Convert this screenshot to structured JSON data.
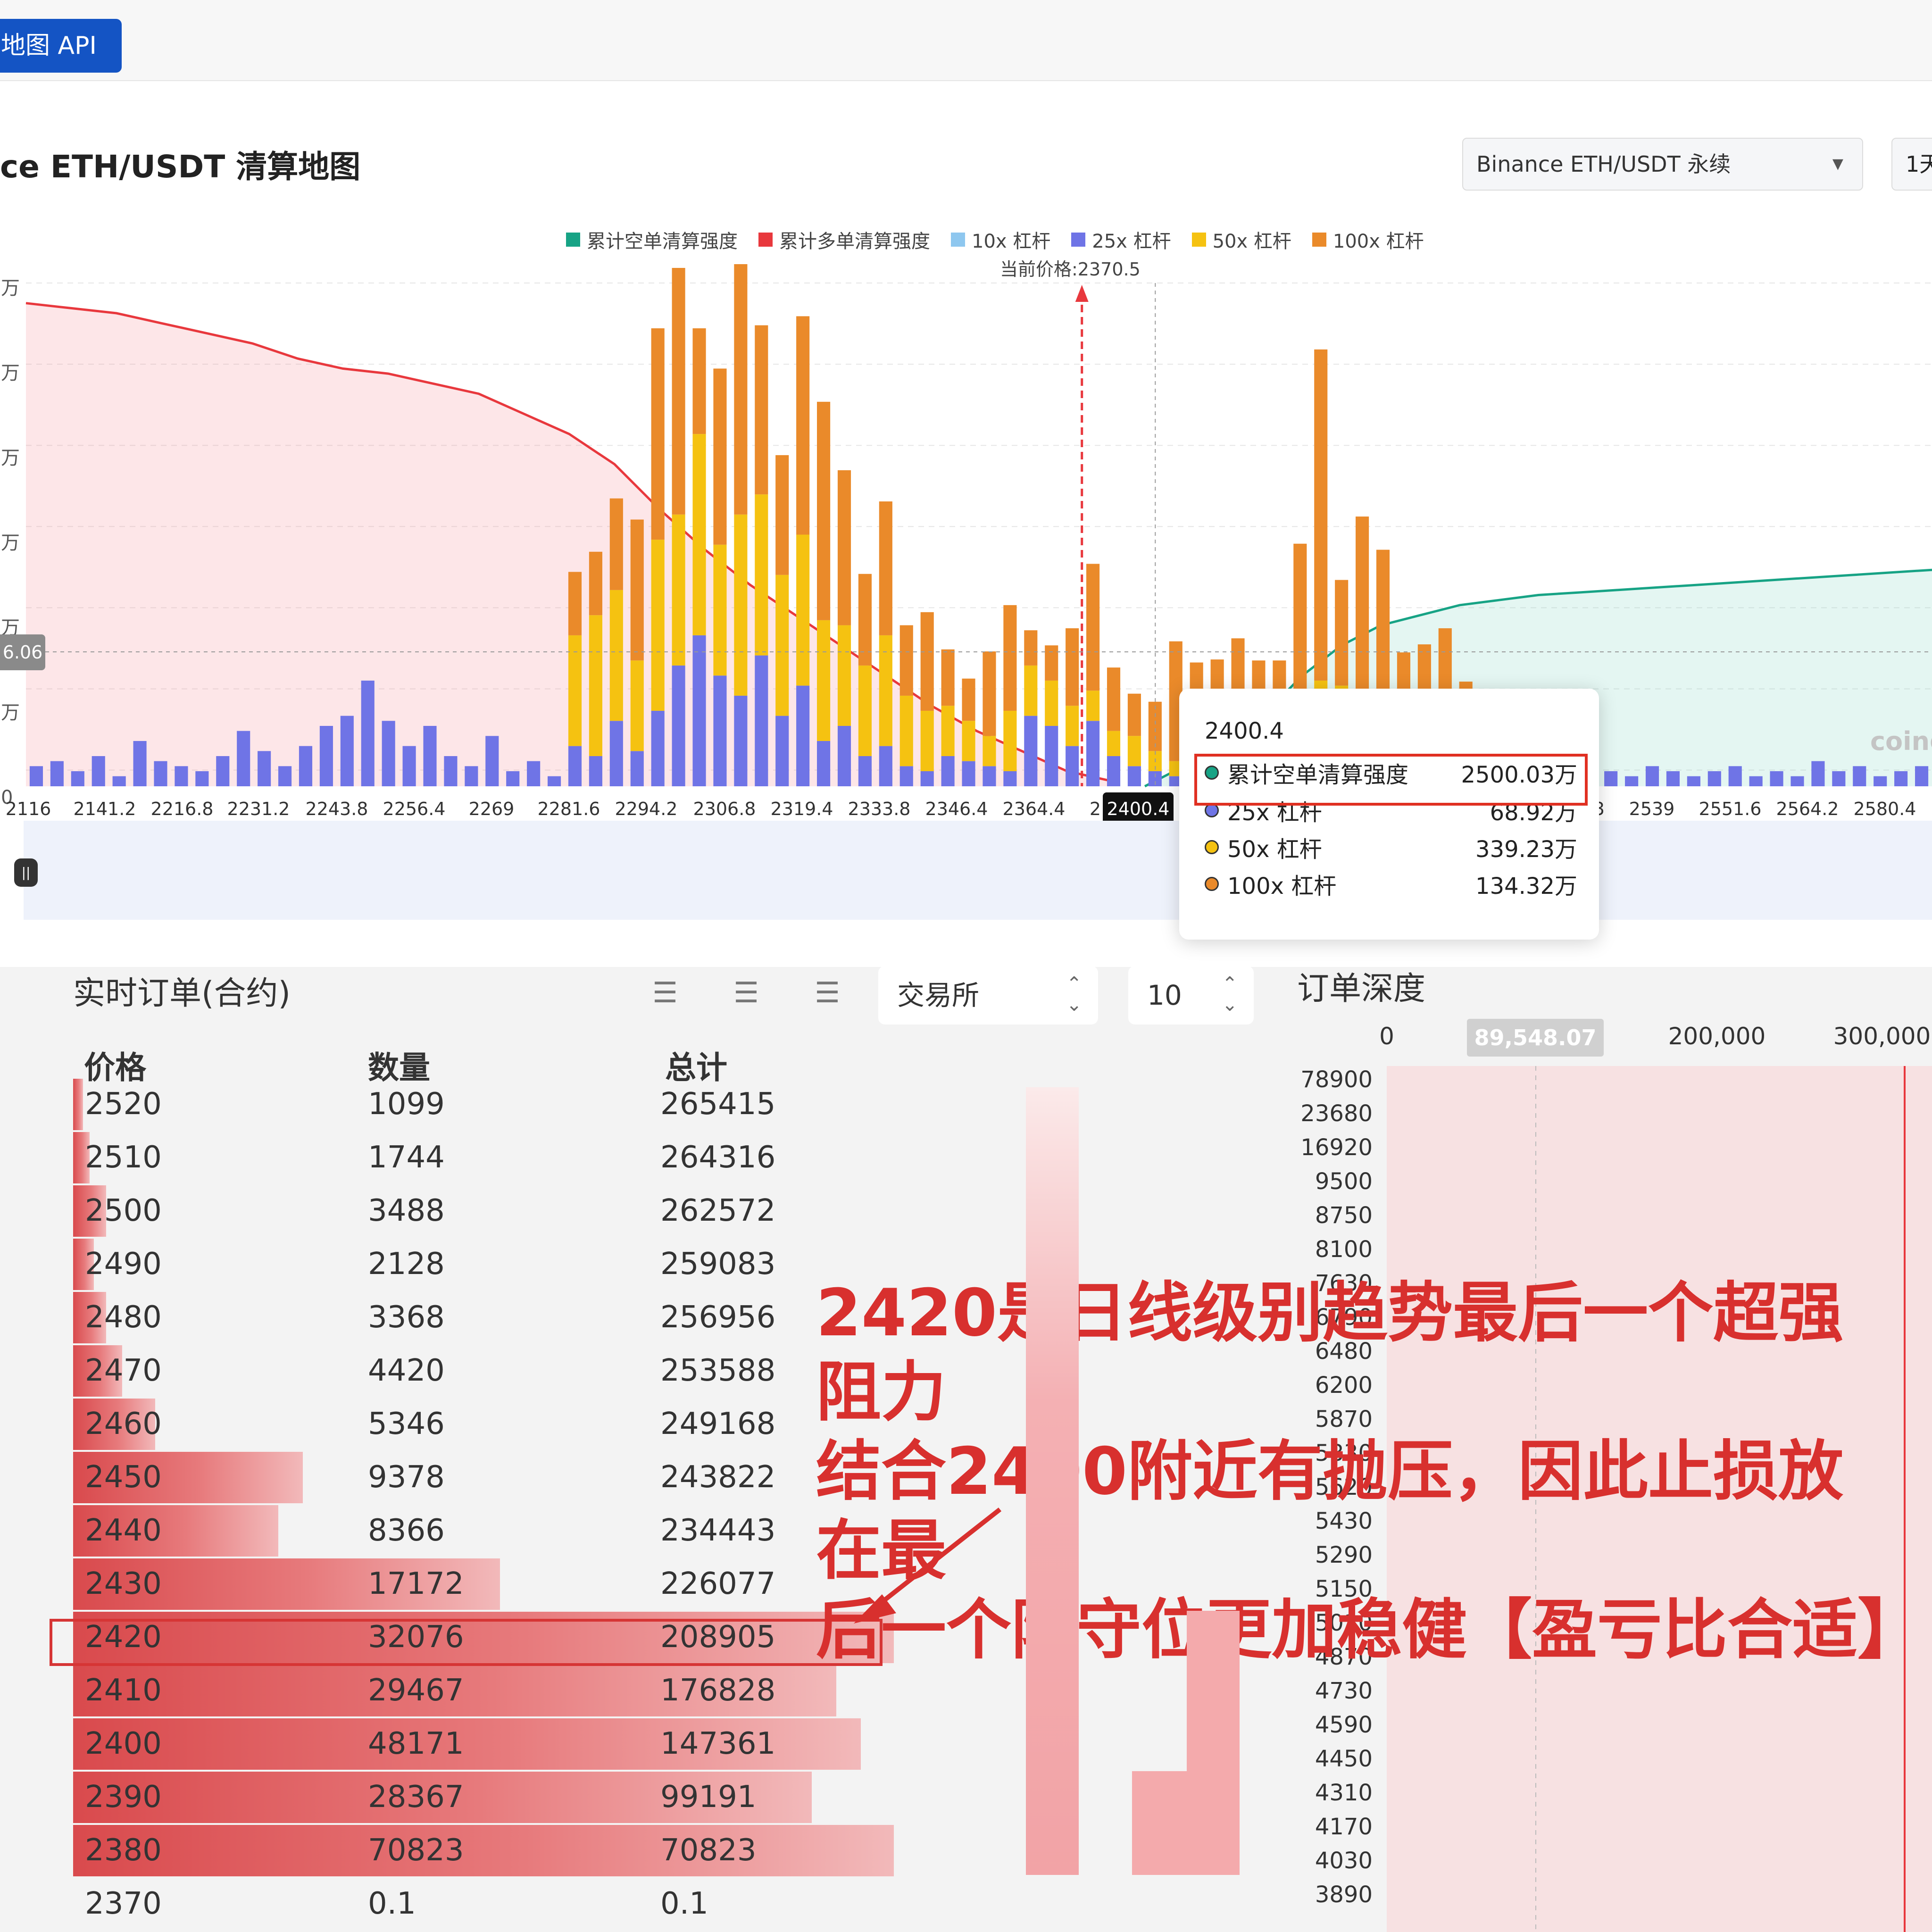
{
  "header": {
    "api_button": "地图 API"
  },
  "title": "ce ETH/USDT 清算地图",
  "market_select": {
    "value": "Binance ETH/USDT 永续"
  },
  "range_select": {
    "value": "1天"
  },
  "legend": [
    {
      "label": "累计空单清算强度",
      "color": "#17a385"
    },
    {
      "label": "累计多单清算强度",
      "color": "#e8383d"
    },
    {
      "label": "10x 杠杆",
      "color": "#8ec7ef"
    },
    {
      "label": "25x 杠杆",
      "color": "#6f74e6"
    },
    {
      "label": "50x 杠杆",
      "color": "#f5c211"
    },
    {
      "label": "100x 杠杆",
      "color": "#ea8a2a"
    }
  ],
  "current_price_note": "当前价格:2370.5",
  "y_cursor_label": "6.06",
  "x_cursor_label": "2400.4",
  "y_tick_fragments": [
    "万",
    "万",
    "万",
    "万",
    "万",
    "万",
    "0"
  ],
  "watermark": "coing",
  "tooltip": {
    "price": "2400.4",
    "rows": [
      {
        "label": "累计空单清算强度",
        "value": "2500.03万",
        "color": "#17a385"
      },
      {
        "label": "25x 杠杆",
        "value": "68.92万",
        "color": "#6f74e6"
      },
      {
        "label": "50x 杠杆",
        "value": "339.23万",
        "color": "#f5c211"
      },
      {
        "label": "100x 杠杆",
        "value": "134.32万",
        "color": "#ea8a2a"
      }
    ]
  },
  "chart_data": {
    "type": "bar",
    "x_ticks": [
      "2116",
      "2141.2",
      "2216.8",
      "2231.2",
      "2243.8",
      "2256.4",
      "2269",
      "2281.6",
      "2294.2",
      "2306.8",
      "2319.4",
      "2333.8",
      "2346.4",
      "2364.4",
      "2",
      "2400.4",
      "3",
      "2539",
      "2551.6",
      "2564.2",
      "2580.4"
    ],
    "current_price": 2370.5,
    "series": [
      {
        "name": "累计多单清算强度",
        "kind": "area",
        "values": [
          96,
          95,
          94,
          92,
          90,
          88,
          85,
          83,
          82,
          80,
          78,
          74,
          70,
          64,
          55,
          47,
          40,
          34,
          28,
          22,
          16,
          11,
          7,
          3,
          1
        ]
      },
      {
        "name": "累计空单清算强度",
        "kind": "area",
        "values": [
          0,
          4,
          8,
          14,
          22,
          28,
          32,
          34,
          36,
          37,
          38,
          38.5,
          39,
          39.5,
          40,
          40.5,
          41,
          41.5,
          42,
          42.5,
          43
        ]
      },
      {
        "name": "25x 杠杆",
        "kind": "bars",
        "values": [
          4,
          5,
          3,
          6,
          2,
          9,
          5,
          4,
          3,
          6,
          11,
          7,
          4,
          8,
          12,
          14,
          21,
          13,
          8,
          12,
          6,
          4,
          10,
          3,
          5,
          2,
          8,
          6,
          13,
          7,
          15,
          24,
          30,
          22,
          18,
          26,
          14,
          20,
          9,
          12,
          6,
          8,
          4,
          3,
          6,
          5,
          4,
          3,
          14,
          12,
          8,
          13,
          6,
          4,
          3,
          2,
          3,
          2,
          4,
          3,
          2,
          2,
          1,
          2,
          2,
          3,
          2,
          1,
          2,
          1,
          1,
          2,
          13,
          3,
          12,
          6,
          3,
          2,
          4,
          3,
          2,
          3,
          4,
          2,
          3,
          2,
          5,
          3,
          4,
          2,
          3,
          4
        ]
      },
      {
        "name": "50x 杠杆",
        "kind": "bars",
        "values": [
          22,
          28,
          26,
          18,
          34,
          30,
          40,
          26,
          36,
          32,
          28,
          30,
          24,
          20,
          18,
          22,
          14,
          12,
          10,
          8,
          6,
          12,
          10,
          9,
          8,
          6,
          5,
          6,
          4,
          3,
          2,
          12,
          10,
          8,
          9,
          14,
          20,
          18,
          11,
          16,
          12,
          9,
          14,
          10
        ]
      },
      {
        "name": "100x 杠杆",
        "kind": "bars",
        "values": [
          18,
          26,
          40,
          60,
          70,
          30,
          50,
          98,
          48,
          34,
          62,
          44,
          26,
          38,
          20,
          28,
          16,
          12,
          24,
          30,
          10,
          22,
          36,
          18,
          12,
          14,
          34,
          28,
          16,
          22,
          20,
          46,
          94,
          30,
          58,
          40,
          18,
          26,
          22,
          14
        ]
      }
    ]
  },
  "orderbook": {
    "title": "实时订单(合约)",
    "exchange_select": "交易所",
    "depth_select": "10",
    "columns": [
      "价格",
      "数量",
      "总计"
    ],
    "rows": [
      {
        "price": "2520",
        "qty": "1099",
        "total": "265415",
        "depth": 0.012
      },
      {
        "price": "2510",
        "qty": "1744",
        "total": "264316",
        "depth": 0.02
      },
      {
        "price": "2500",
        "qty": "3488",
        "total": "262572",
        "depth": 0.04
      },
      {
        "price": "2490",
        "qty": "2128",
        "total": "259083",
        "depth": 0.025
      },
      {
        "price": "2480",
        "qty": "3368",
        "total": "256956",
        "depth": 0.04
      },
      {
        "price": "2470",
        "qty": "4420",
        "total": "253588",
        "depth": 0.06
      },
      {
        "price": "2460",
        "qty": "5346",
        "total": "249168",
        "depth": 0.1
      },
      {
        "price": "2450",
        "qty": "9378",
        "total": "243822",
        "depth": 0.28
      },
      {
        "price": "2440",
        "qty": "8366",
        "total": "234443",
        "depth": 0.25
      },
      {
        "price": "2430",
        "qty": "17172",
        "total": "226077",
        "depth": 0.52
      },
      {
        "price": "2420",
        "qty": "32076",
        "total": "208905",
        "depth": 1.0
      },
      {
        "price": "2410",
        "qty": "29467",
        "total": "176828",
        "depth": 0.93
      },
      {
        "price": "2400",
        "qty": "48171",
        "total": "147361",
        "depth": 0.96
      },
      {
        "price": "2390",
        "qty": "28367",
        "total": "99191",
        "depth": 0.9
      },
      {
        "price": "2380",
        "qty": "70823",
        "total": "70823",
        "depth": 1.0
      },
      {
        "price": "2370",
        "qty": "0.1",
        "total": "0.1",
        "depth": 0
      }
    ]
  },
  "depth_panel": {
    "title": "订单深度",
    "x_ticks": [
      "0",
      "89,548.07",
      "200,000",
      "300,000"
    ],
    "y_ticks": [
      "78900",
      "23680",
      "16920",
      "9500",
      "8750",
      "8100",
      "7630",
      "6790",
      "6480",
      "6200",
      "5870",
      "5830",
      "5620",
      "5430",
      "5290",
      "5150",
      "5010",
      "4870",
      "4730",
      "4590",
      "4450",
      "4310",
      "4170",
      "4030",
      "3890"
    ]
  },
  "annotation": {
    "lines": [
      "2420是日线级别趋势最后一个超强阻力",
      "结合2400附近有抛压，因此止损放在最",
      "后一个防守位更加稳健【盈亏比合适】"
    ]
  }
}
